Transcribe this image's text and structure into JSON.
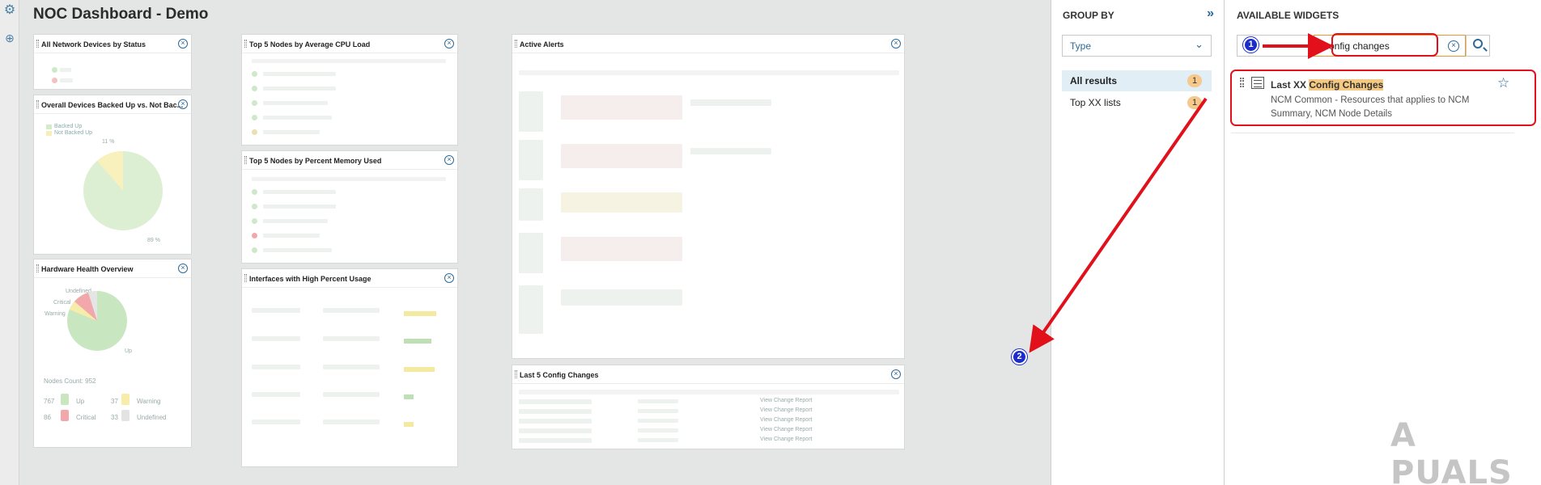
{
  "dashboard": {
    "title": "NOC Dashboard - Demo",
    "widgets": {
      "devices_status": "All Network Devices by Status",
      "devices_backed_up": "Overall Devices Backed Up vs. Not Bac...",
      "hardware_health": "Hardware Health Overview",
      "top_cpu": "Top 5 Nodes by Average CPU Load",
      "top_memory": "Top 5 Nodes by Percent Memory Used",
      "interfaces": "Interfaces with High Percent Usage",
      "active_alerts": "Active Alerts",
      "last_config": "Last 5 Config Changes"
    },
    "backed_up_legend": [
      "Backed Up",
      "Not Backed Up"
    ],
    "backed_up_pcts": [
      "11 %",
      "89 %"
    ],
    "hardware_labels": [
      "Undefined",
      "Critical",
      "Warning",
      "Up"
    ],
    "nodes_count": "Nodes Count: 952",
    "hardware_stats": [
      {
        "value": "767",
        "label": "Up"
      },
      {
        "value": "37",
        "label": "Warning"
      },
      {
        "value": "86",
        "label": "Critical"
      },
      {
        "value": "33",
        "label": "Undefined"
      }
    ],
    "config_change_link": "View Change Report"
  },
  "group_by": {
    "heading": "GROUP BY",
    "select_value": "Type",
    "items": [
      {
        "label": "All results",
        "count": "1"
      },
      {
        "label": "Top XX lists",
        "count": "1"
      }
    ]
  },
  "available_widgets": {
    "heading": "AVAILABLE WIDGETS",
    "search_value": "config changes",
    "result": {
      "title_prefix": "Last XX ",
      "title_highlight": "Config Changes",
      "description": "NCM Common - Resources that applies to NCM Summary, NCM Node Details"
    }
  },
  "annotations": {
    "badge1": "1",
    "badge2": "2",
    "watermark": "A PUALS"
  },
  "colors": {
    "accent": "#2d6a99",
    "highlight": "#f6c982",
    "annotation_red": "#e1101b",
    "badge_blue": "#1b2bcc"
  }
}
